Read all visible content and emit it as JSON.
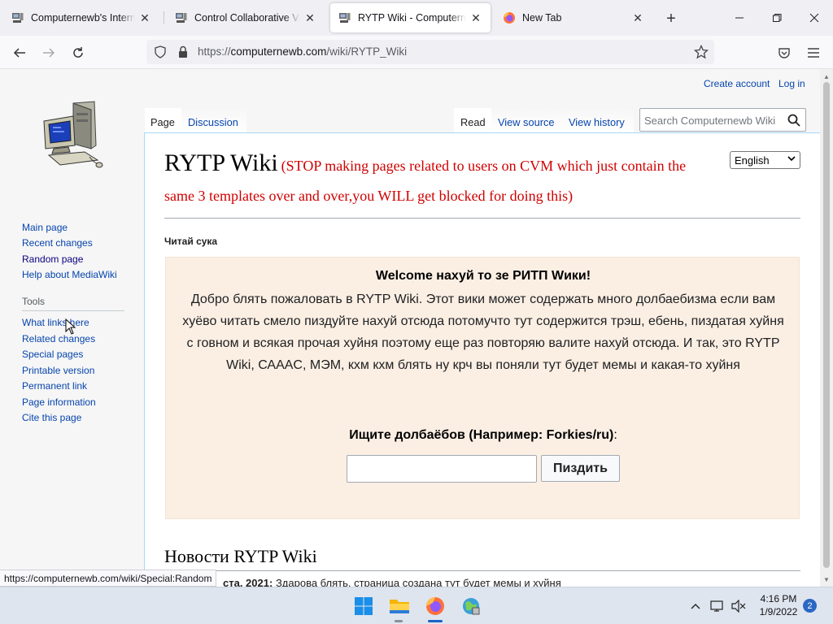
{
  "browser": {
    "tabs": [
      {
        "title": "Computernewb's Internet P",
        "active": false
      },
      {
        "title": "Control Collaborative Virtu",
        "active": false
      },
      {
        "title": "RYTP Wiki - Computernewb",
        "active": true
      },
      {
        "title": "New Tab",
        "active": false
      }
    ],
    "url_prefix": "https://",
    "url_host": "computernewb.com",
    "url_path": "/wiki/RYTP_Wiki",
    "status_url": "https://computernewb.com/wiki/Special:Random"
  },
  "wiki": {
    "personal": {
      "create_account": "Create account",
      "log_in": "Log in"
    },
    "sidebar": {
      "nav": [
        {
          "label": "Main page"
        },
        {
          "label": "Recent changes"
        },
        {
          "label": "Random page"
        },
        {
          "label": "Help about MediaWiki"
        }
      ],
      "tools_heading": "Tools",
      "tools": [
        {
          "label": "What links here"
        },
        {
          "label": "Related changes"
        },
        {
          "label": "Special pages"
        },
        {
          "label": "Printable version"
        },
        {
          "label": "Permanent link"
        },
        {
          "label": "Page information"
        },
        {
          "label": "Cite this page"
        }
      ]
    },
    "tabs_left": [
      "Page",
      "Discussion"
    ],
    "tabs_right": [
      "Read",
      "View source",
      "View history"
    ],
    "search_placeholder": "Search Computernewb Wiki",
    "language": "English",
    "title": "RYTP Wiki",
    "title_note": "(STOP making pages related to users on CVM which just contain the same 3 templates over and over,you WILL get blocked for doing this)",
    "subtext": "Читай сука",
    "welcome": {
      "title": "Welcome нахуй то зе РИТП Wики!",
      "body": "Добро блять пожаловать в RYTP Wiki. Этот вики может содержать много долбаебизма если вам хуёво читать смело пиздуйте нахуй отсюда потомучто тут содержится трэш, ебень, пиздатая хуйня с говном и всякая прочая хуйня поэтому еще раз повторяю валите нахуй отсюда. И так, это RYTP Wiki, СААAC, МЭМ, кхм кхм блять ну крч вы поняли тут будет мемы и какая-то хуйня",
      "search_label": "Ищите долбаёбов (Например: Forkies/ru)",
      "search_label_suffix": ":",
      "button": "Пиздить"
    },
    "news_heading": "Новости RYTP Wiki",
    "news_item_date": "ста. 2021:",
    "news_item_text": "Здарова блять, страница создана тут будет мемы и хуйня"
  },
  "taskbar": {
    "time": "4:16 PM",
    "date": "1/9/2022",
    "notifications": "2"
  },
  "colors": {
    "link": "#0645ad",
    "title_note": "#d00000",
    "welcome_bg": "#fbefe4",
    "taskbar": "#dfe5ef"
  }
}
